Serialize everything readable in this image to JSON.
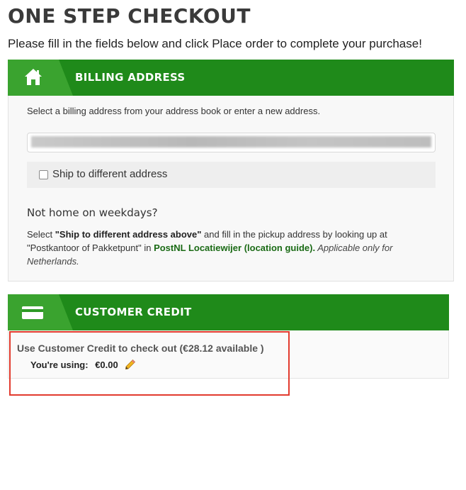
{
  "page": {
    "title": "ONE STEP CHECKOUT",
    "subtitle": "Please fill in the fields below and click Place order to complete your purchase!"
  },
  "billing": {
    "header": "BILLING ADDRESS",
    "header_icon": "home-icon",
    "intro": "Select a billing address from your address book or enter a new address.",
    "address_select_value": "",
    "ship_different_label": "Ship to different address",
    "ship_different_checked": false,
    "not_home_heading": "Not home on weekdays?",
    "pickup": {
      "prefix": "Select ",
      "bold": "\"Ship to different address above\"",
      "middle": " and fill in the pickup address by looking up at \"Postkantoor of Pakketpunt\" in ",
      "link": "PostNL Locatiewijer (location guide).",
      "italic": " Applicable only for Netherlands."
    }
  },
  "credit": {
    "header": "CUSTOMER CREDIT",
    "header_icon": "credit-card-icon",
    "use_label": "Use Customer Credit to check out (€28.12 available )",
    "using_label": "You're using:",
    "using_amount": "€0.00",
    "edit_icon": "pencil-icon"
  },
  "colors": {
    "header_green": "#1f8a1a",
    "tab_green": "#3aa32f",
    "highlight_red": "#e23b2e",
    "link_green": "#1a6a15"
  }
}
